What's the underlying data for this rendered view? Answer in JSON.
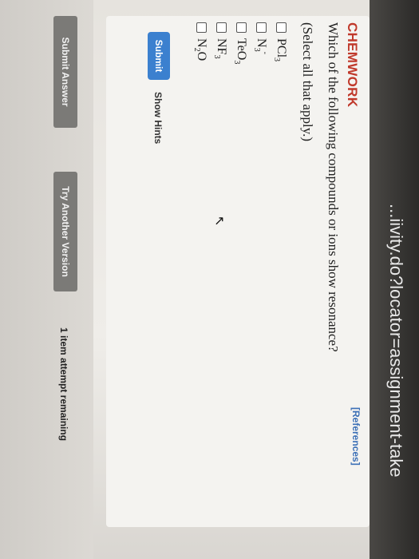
{
  "browser": {
    "url_fragment": "...iivity.do?locator=assignment-take"
  },
  "card": {
    "references": "[References]",
    "title": "CHEMWORK",
    "question": "Which of the following compounds or ions show resonance?",
    "instruction": "(Select all that apply.)",
    "options": [
      {
        "base": "PCl",
        "sub": "3",
        "sup": "",
        "checked": false
      },
      {
        "base": "N",
        "sub": "3",
        "sup": "-",
        "checked": false
      },
      {
        "base": "TeO",
        "sub": "3",
        "sup": "",
        "checked": false
      },
      {
        "base": "NF",
        "sub": "3",
        "sup": "",
        "checked": false
      },
      {
        "base": "N",
        "sub": "2",
        "sup": "",
        "tail": "O",
        "checked": false
      }
    ],
    "submit_label": "Submit",
    "hints_label": "Show Hints"
  },
  "footer": {
    "submit_answer": "Submit Answer",
    "try_another": "Try Another Version",
    "attempts": "1 item attempt remaining"
  },
  "colors": {
    "accent": "#3b80cf",
    "title_red": "#c0392b",
    "references_blue": "#3b6fb6",
    "footer_button": "#7b7a77"
  },
  "icons": {
    "cursor": "mouse-pointer-icon"
  }
}
